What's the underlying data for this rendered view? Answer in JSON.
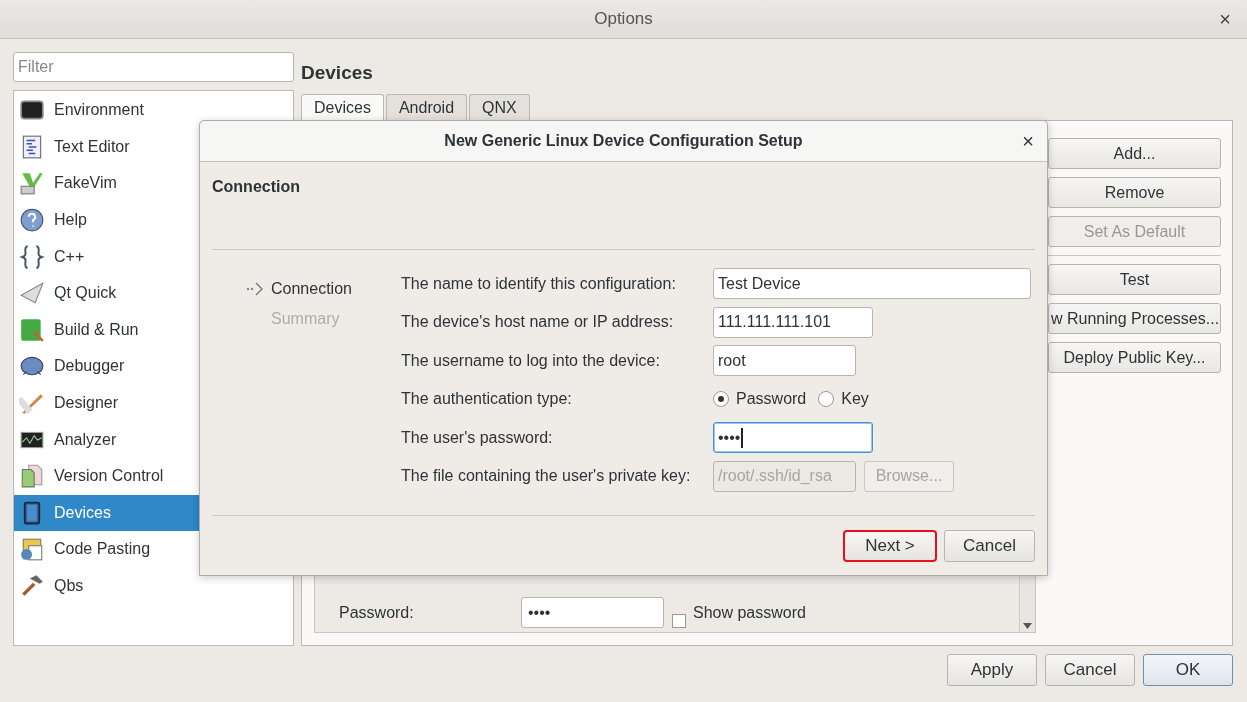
{
  "window": {
    "title": "Options",
    "close": "×"
  },
  "filter": {
    "placeholder": "Filter"
  },
  "sidebar": {
    "items": [
      {
        "label": "Environment",
        "selected": false
      },
      {
        "label": "Text Editor",
        "selected": false
      },
      {
        "label": "FakeVim",
        "selected": false
      },
      {
        "label": "Help",
        "selected": false
      },
      {
        "label": "C++",
        "selected": false
      },
      {
        "label": "Qt Quick",
        "selected": false
      },
      {
        "label": "Build & Run",
        "selected": false
      },
      {
        "label": "Debugger",
        "selected": false
      },
      {
        "label": "Designer",
        "selected": false
      },
      {
        "label": "Analyzer",
        "selected": false
      },
      {
        "label": "Version Control",
        "selected": false
      },
      {
        "label": "Devices",
        "selected": true
      },
      {
        "label": "Code Pasting",
        "selected": false
      },
      {
        "label": "Qbs",
        "selected": false
      }
    ]
  },
  "page": {
    "title": "Devices",
    "tabs": [
      {
        "label": "Devices",
        "selected": true
      },
      {
        "label": "Android",
        "selected": false
      },
      {
        "label": "QNX",
        "selected": false
      }
    ],
    "device_buttons": [
      {
        "label": "Add...",
        "disabled": false
      },
      {
        "label": "Remove",
        "disabled": false
      },
      {
        "label": "Set As Default",
        "disabled": true
      },
      {
        "label": "Test",
        "disabled": false
      },
      {
        "label": "w Running Processes...",
        "disabled": false
      },
      {
        "label": "Deploy Public Key...",
        "disabled": false
      }
    ],
    "password": {
      "label": "Password:",
      "value": "••••",
      "show_password": {
        "label": "Show password",
        "checked": false
      }
    }
  },
  "dialog": {
    "title": "New Generic Linux Device Configuration Setup",
    "close": "×",
    "heading": "Connection",
    "steps": [
      {
        "label": "Connection",
        "current": true
      },
      {
        "label": "Summary",
        "current": false
      }
    ],
    "rows": [
      {
        "kind": "text",
        "label": "The name to identify this configuration:",
        "value": "Test Device"
      },
      {
        "kind": "text",
        "label": "The device's host name or IP address:",
        "value": "111.111.111.101"
      },
      {
        "kind": "text",
        "label": "The username to log into the device:",
        "value": "root"
      },
      {
        "kind": "radio",
        "label": "The authentication type:",
        "options": [
          {
            "label": "Password",
            "selected": true
          },
          {
            "label": "Key",
            "selected": false
          }
        ]
      },
      {
        "kind": "password",
        "label": "The user's password:",
        "value": "••••",
        "focused": true
      },
      {
        "kind": "file",
        "label": "The file containing the user's private key:",
        "value": "/root/.ssh/id_rsa",
        "button": "Browse...",
        "disabled": true
      }
    ],
    "buttons": [
      {
        "label": "Next >",
        "highlighted": true
      },
      {
        "label": "Cancel",
        "highlighted": false
      }
    ]
  },
  "buttons": [
    {
      "label": "Apply",
      "default": false
    },
    {
      "label": "Cancel",
      "default": false
    },
    {
      "label": "OK",
      "default": true
    }
  ]
}
